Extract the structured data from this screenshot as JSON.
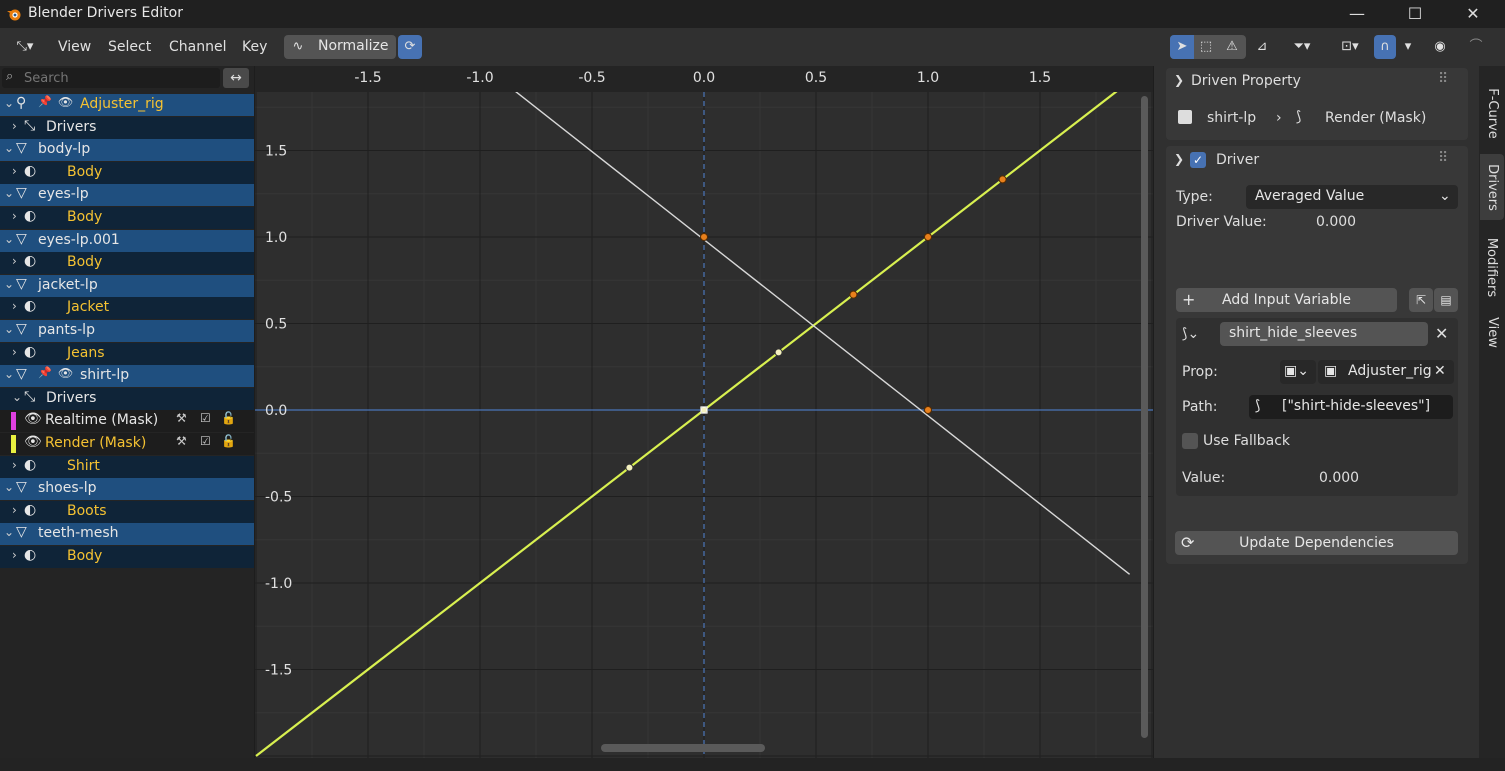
{
  "window": {
    "title": "Blender Drivers Editor",
    "minimize": "—",
    "maximize": "☐",
    "close": "✕"
  },
  "header": {
    "menus": [
      "View",
      "Select",
      "Channel",
      "Key"
    ],
    "normalize_label": "Normalize"
  },
  "search": {
    "placeholder": "Search"
  },
  "outliner": [
    {
      "label": "Adjuster_rig",
      "style": "obj",
      "indent": 0,
      "expanded": true,
      "color": "yellow",
      "icon": "armature-icon"
    },
    {
      "label": "Drivers",
      "style": "sub",
      "indent": 1,
      "expanded": false,
      "color": "white",
      "icon": "drivers-icon"
    },
    {
      "label": "body-lp",
      "style": "obj",
      "indent": 0,
      "expanded": true,
      "color": "white",
      "icon": "mesh-icon"
    },
    {
      "label": "Body",
      "style": "sub",
      "indent": 1,
      "expanded": false,
      "color": "yellow",
      "icon": "material-icon"
    },
    {
      "label": "eyes-lp",
      "style": "obj",
      "indent": 0,
      "expanded": true,
      "color": "white",
      "icon": "mesh-icon"
    },
    {
      "label": "Body",
      "style": "sub",
      "indent": 1,
      "expanded": false,
      "color": "yellow",
      "icon": "material-icon"
    },
    {
      "label": "eyes-lp.001",
      "style": "obj",
      "indent": 0,
      "expanded": true,
      "color": "white",
      "icon": "mesh-icon"
    },
    {
      "label": "Body",
      "style": "sub",
      "indent": 1,
      "expanded": false,
      "color": "yellow",
      "icon": "material-icon"
    },
    {
      "label": "jacket-lp",
      "style": "obj",
      "indent": 0,
      "expanded": true,
      "color": "white",
      "icon": "mesh-icon"
    },
    {
      "label": "Jacket",
      "style": "sub",
      "indent": 1,
      "expanded": false,
      "color": "yellow",
      "icon": "material-icon"
    },
    {
      "label": "pants-lp",
      "style": "obj",
      "indent": 0,
      "expanded": true,
      "color": "white",
      "icon": "mesh-icon"
    },
    {
      "label": "Jeans",
      "style": "sub",
      "indent": 1,
      "expanded": false,
      "color": "yellow",
      "icon": "material-icon"
    },
    {
      "label": "shirt-lp",
      "style": "obj",
      "indent": 0,
      "expanded": true,
      "color": "white",
      "icon": "mesh-icon"
    },
    {
      "label": "Drivers",
      "style": "sub",
      "indent": 1,
      "expanded": true,
      "color": "white",
      "icon": "drivers-icon"
    },
    {
      "label": "Realtime (Mask)",
      "style": "plain",
      "indent": 2,
      "color": "white",
      "icon": "eye-icon",
      "swatch": "#e040e0"
    },
    {
      "label": "Render (Mask)",
      "style": "plain",
      "indent": 2,
      "color": "yellow",
      "icon": "eye-icon",
      "swatch": "#e8f040"
    },
    {
      "label": "Shirt",
      "style": "sub",
      "indent": 1,
      "expanded": false,
      "color": "yellow",
      "icon": "material-icon"
    },
    {
      "label": "shoes-lp",
      "style": "obj",
      "indent": 0,
      "expanded": true,
      "color": "white",
      "icon": "mesh-icon"
    },
    {
      "label": "Boots",
      "style": "sub",
      "indent": 1,
      "expanded": false,
      "color": "yellow",
      "icon": "material-icon"
    },
    {
      "label": "teeth-mesh",
      "style": "obj",
      "indent": 0,
      "expanded": true,
      "color": "white",
      "icon": "mesh-icon"
    },
    {
      "label": "Body",
      "style": "sub",
      "indent": 1,
      "expanded": false,
      "color": "yellow",
      "icon": "material-icon"
    }
  ],
  "graph": {
    "x_ticks": [
      "-1.5",
      "-1.0",
      "-0.5",
      "0.0",
      "0.5",
      "1.0",
      "1.5"
    ],
    "y_ticks": [
      "1.5",
      "1.0",
      "0.5",
      "0.0",
      "-0.5",
      "-1.0",
      "-1.5"
    ],
    "curves": [
      {
        "name": "Render (Mask)",
        "color": "#d8f050",
        "points": [
          [
            -2.0,
            -2.0
          ],
          [
            2.0,
            2.0
          ]
        ]
      },
      {
        "name": "Realtime (Mask)",
        "color": "#d8d8d8",
        "points": [
          [
            -0.85,
            1.85
          ],
          [
            1.9,
            -0.95
          ]
        ]
      }
    ],
    "keyframes_yellow": [
      [
        -0.333,
        -0.333
      ],
      [
        0.333,
        0.333
      ],
      [
        0.0,
        0.0
      ]
    ],
    "keyframes_orange": [
      [
        0.667,
        0.667
      ],
      [
        1.0,
        1.0
      ],
      [
        1.333,
        1.333
      ],
      [
        0.0,
        1.0
      ],
      [
        1.0,
        0.0
      ]
    ]
  },
  "driven_property": {
    "header": "Driven Property",
    "object": "shirt-lp",
    "property": "Render (Mask)"
  },
  "driver": {
    "header": "Driver",
    "type_label": "Type:",
    "type_value": "Averaged Value",
    "value_label": "Driver Value:",
    "value": "0.000",
    "add_variable": "Add Input Variable",
    "variable_name": "shirt_hide_sleeves",
    "prop_label": "Prop:",
    "prop_value": "Adjuster_rig",
    "path_label": "Path:",
    "path_value": "[\"shirt-hide-sleeves\"]",
    "fallback_label": "Use Fallback",
    "var_value_label": "Value:",
    "var_value": "0.000",
    "update_deps": "Update Dependencies"
  },
  "tabs": [
    "F-Curve",
    "Drivers",
    "Modifiers",
    "View"
  ]
}
